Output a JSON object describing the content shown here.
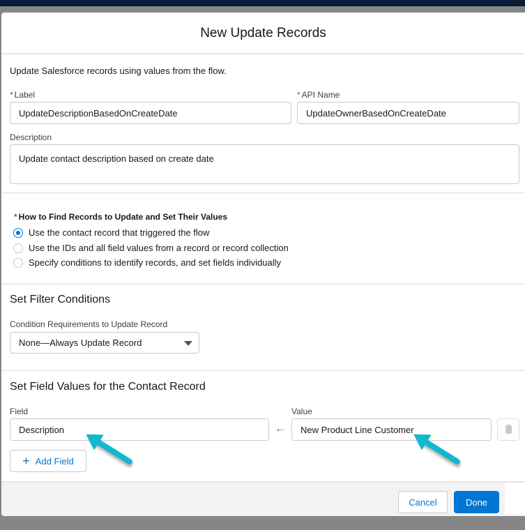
{
  "modal": {
    "title": "New Update Records",
    "intro": "Update Salesforce records using values from the flow."
  },
  "form": {
    "required_mark": "*",
    "label_label": "Label",
    "label_value": "UpdateDescriptionBasedOnCreateDate",
    "api_label": "API Name",
    "api_value": "UpdateOwnerBasedOnCreateDate",
    "desc_label": "Description",
    "desc_value": "Update contact description based on create date"
  },
  "how": {
    "heading": "How to Find Records to Update and Set Their Values",
    "options": [
      "Use the contact record that triggered the flow",
      "Use the IDs and all field values from a record or record collection",
      "Specify conditions to identify records, and set fields individually"
    ],
    "selected": 0
  },
  "filter": {
    "heading": "Set Filter Conditions",
    "label": "Condition Requirements to Update Record",
    "value": "None—Always Update Record"
  },
  "fields": {
    "heading": "Set Field Values for the Contact Record",
    "field_label": "Field",
    "field_value": "Description",
    "value_label": "Value",
    "value_value": "New Product Line Customer",
    "add_label": "Add Field"
  },
  "footer": {
    "cancel": "Cancel",
    "done": "Done"
  },
  "colors": {
    "brand": "#0176d3",
    "annotation": "#10b8d0"
  }
}
